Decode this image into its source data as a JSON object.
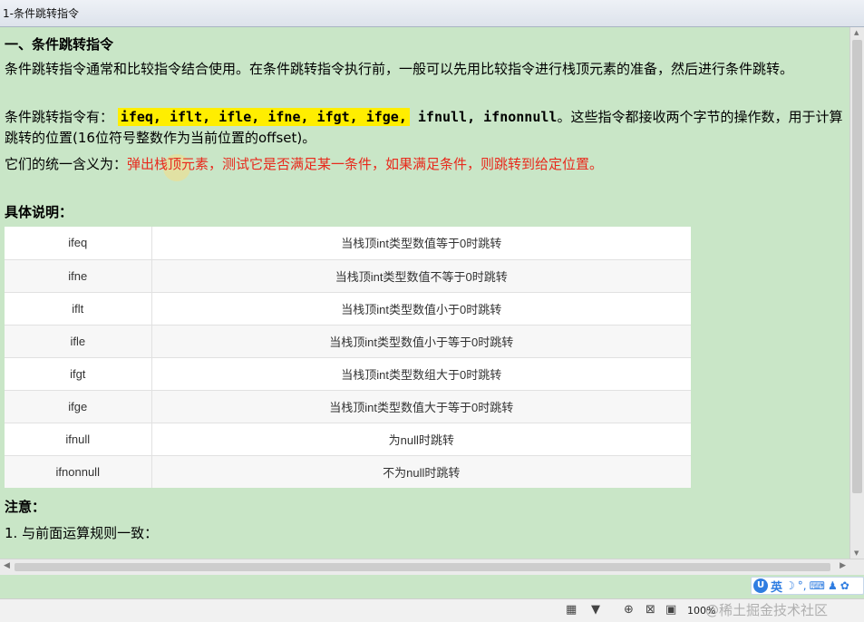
{
  "window": {
    "title": "1-条件跳转指令"
  },
  "doc": {
    "heading": "一、条件跳转指令",
    "intro": "条件跳转指令通常和比较指令结合使用。在条件跳转指令执行前，一般可以先用比较指令进行栈顶元素的准备，然后进行条件跳转。",
    "list_prefix": "条件跳转指令有：",
    "list_highlighted": "ifeq, iflt, ifle, ifne, ifgt, ifge,",
    "list_rest": " ifnull, ifnonnull",
    "list_suffix": "。这些指令都接收两个字节的操作数，用于计算跳转的位置(16位符号整数作为当前位置的offset)。",
    "meaning_prefix": "它们的统一含义为：",
    "meaning_red": "弹出栈顶元素，测试它是否满足某一条件，如果满足条件，则跳转到给定位置。",
    "details_heading": "具体说明：",
    "table": {
      "rows": [
        {
          "op": "ifeq",
          "desc": "当栈顶int类型数值等于0时跳转"
        },
        {
          "op": "ifne",
          "desc": "当栈顶int类型数值不等于0时跳转"
        },
        {
          "op": "iflt",
          "desc": "当栈顶int类型数值小于0时跳转"
        },
        {
          "op": "ifle",
          "desc": "当栈顶int类型数值小于等于0时跳转"
        },
        {
          "op": "ifgt",
          "desc": "当栈顶int类型数组大于0时跳转"
        },
        {
          "op": "ifge",
          "desc": "当栈顶int类型数值大于等于0时跳转"
        },
        {
          "op": "ifnull",
          "desc": "为null时跳转"
        },
        {
          "op": "ifnonnull",
          "desc": "不为null时跳转"
        }
      ]
    },
    "note_heading": "注意：",
    "note_1": "1. 与前面运算规则一致："
  },
  "ime": {
    "logo": "U",
    "lang": "英",
    "moon": "☽",
    "punct": "°,",
    "keyboard": "⌨",
    "user": "♟",
    "skin": "✿"
  },
  "status": {
    "zoom": "100%",
    "watermark": "@稀土掘金技术社区",
    "filter_icon": "▼",
    "layout_icon": "▦"
  },
  "colors": {
    "background": "#c9e6c7",
    "highlight": "#ffee00",
    "red_text": "#e8291c"
  }
}
